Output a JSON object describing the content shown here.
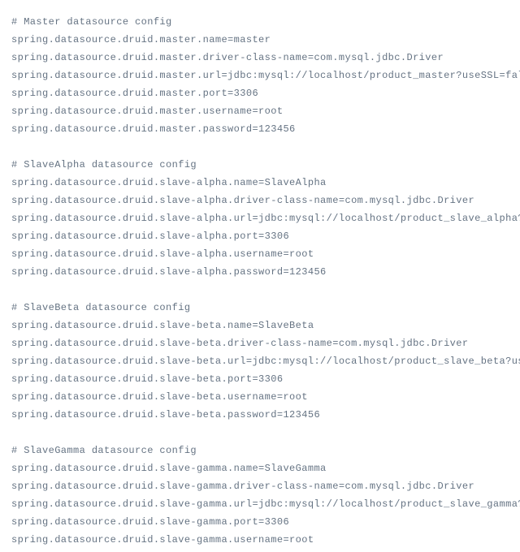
{
  "lines": [
    "# Master datasource config",
    "spring.datasource.druid.master.name=master",
    "spring.datasource.druid.master.driver-class-name=com.mysql.jdbc.Driver",
    "spring.datasource.druid.master.url=jdbc:mysql://localhost/product_master?useSSL=false",
    "spring.datasource.druid.master.port=3306",
    "spring.datasource.druid.master.username=root",
    "spring.datasource.druid.master.password=123456",
    "",
    "# SlaveAlpha datasource config",
    "spring.datasource.druid.slave-alpha.name=SlaveAlpha",
    "spring.datasource.druid.slave-alpha.driver-class-name=com.mysql.jdbc.Driver",
    "spring.datasource.druid.slave-alpha.url=jdbc:mysql://localhost/product_slave_alpha?useSSL=f",
    "spring.datasource.druid.slave-alpha.port=3306",
    "spring.datasource.druid.slave-alpha.username=root",
    "spring.datasource.druid.slave-alpha.password=123456",
    "",
    "# SlaveBeta datasource config",
    "spring.datasource.druid.slave-beta.name=SlaveBeta",
    "spring.datasource.druid.slave-beta.driver-class-name=com.mysql.jdbc.Driver",
    "spring.datasource.druid.slave-beta.url=jdbc:mysql://localhost/product_slave_beta?useSSL=fal",
    "spring.datasource.druid.slave-beta.port=3306",
    "spring.datasource.druid.slave-beta.username=root",
    "spring.datasource.druid.slave-beta.password=123456",
    "",
    "# SlaveGamma datasource config",
    "spring.datasource.druid.slave-gamma.name=SlaveGamma",
    "spring.datasource.druid.slave-gamma.driver-class-name=com.mysql.jdbc.Driver",
    "spring.datasource.druid.slave-gamma.url=jdbc:mysql://localhost/product_slave_gamma?useSSL=f",
    "spring.datasource.druid.slave-gamma.port=3306",
    "spring.datasource.druid.slave-gamma.username=root"
  ]
}
